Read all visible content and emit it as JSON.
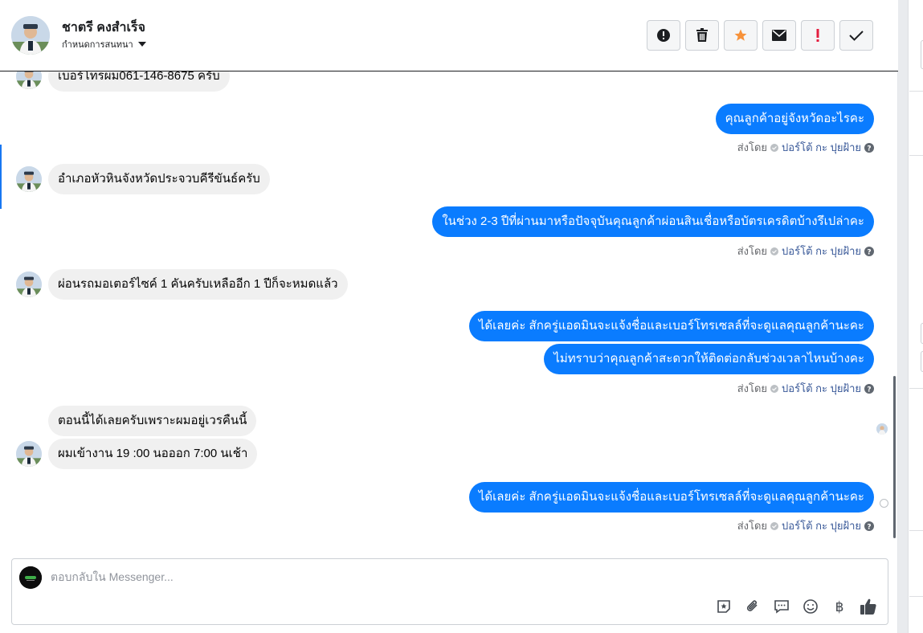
{
  "header": {
    "name": "ชาตรี คงสำเร็จ",
    "subtitle": "กำหนดการสนทนา",
    "actions": [
      {
        "icon": "alert-circle-icon",
        "name": "mark-spam-button"
      },
      {
        "icon": "trash-icon",
        "name": "delete-button"
      },
      {
        "icon": "star-icon",
        "name": "star-button"
      },
      {
        "icon": "envelope-icon",
        "name": "mark-unread-button"
      },
      {
        "icon": "exclamation-icon",
        "name": "follow-up-button"
      },
      {
        "icon": "check-icon",
        "name": "mark-done-button"
      }
    ]
  },
  "thread": {
    "messages": [
      {
        "dir": "in",
        "text": "เบอร์โทรผม061-146-8675 ครับ"
      },
      {
        "dir": "out",
        "text": "คุณลูกค้าอยู่จังหวัดอะไรคะ"
      },
      {
        "dir": "in",
        "text": "อำเภอหัวหินจังหวัดประจวบคีรีขันธ์ครับ"
      },
      {
        "dir": "out",
        "text": "ในช่วง 2-3 ปีที่ผ่านมาหรือปัจจุบันคุณลูกค้าผ่อนสินเชื่อหรือบัตรเครดิตบ้างรึเปล่าคะ"
      },
      {
        "dir": "in",
        "text": "ผ่อนรถมอเตอร์ไซค์ 1 คันครับเหลืออีก 1 ปีก็จะหมดแล้ว"
      },
      {
        "dir": "out",
        "text": "ได้เลยค่ะ สักครู่แอดมินจะแจ้งชื่อและเบอร์โทรเซลล์ที่จะดูแลคุณลูกค้านะคะ"
      },
      {
        "dir": "out",
        "text": "ไม่ทราบว่าคุณลูกค้าสะดวกให้ติดต่อกลับช่วงเวลาไหนบ้างคะ"
      },
      {
        "dir": "in",
        "text": "ตอนนี้ได้เลยครับเพราะผมอยู่เวรคืนนี้"
      },
      {
        "dir": "in",
        "text": "ผมเข้างาน 19 :00 นอออก 7:00 นเช้า"
      },
      {
        "dir": "out",
        "text": "ได้เลยค่ะ สักครู่แอดมินจะแจ้งชื่อและเบอร์โทรเซลล์ที่จะดูแลคุณลูกค้านะคะ"
      }
    ],
    "sent_by_label": "ส่งโดย",
    "sent_by_name": "ปอร์โต้ กะ ปุยฝ้าย"
  },
  "composer": {
    "placeholder": "ตอบกลับใน Messenger...",
    "tools": [
      "sticker-icon",
      "paperclip-icon",
      "saved-reply-icon",
      "emoji-icon",
      "baht-icon",
      "thumbs-up-icon"
    ]
  },
  "colors": {
    "outgoing": "#0a7cff",
    "incoming": "#f0f0f0",
    "star": "#f7923a",
    "alert": "#e41e3f"
  }
}
